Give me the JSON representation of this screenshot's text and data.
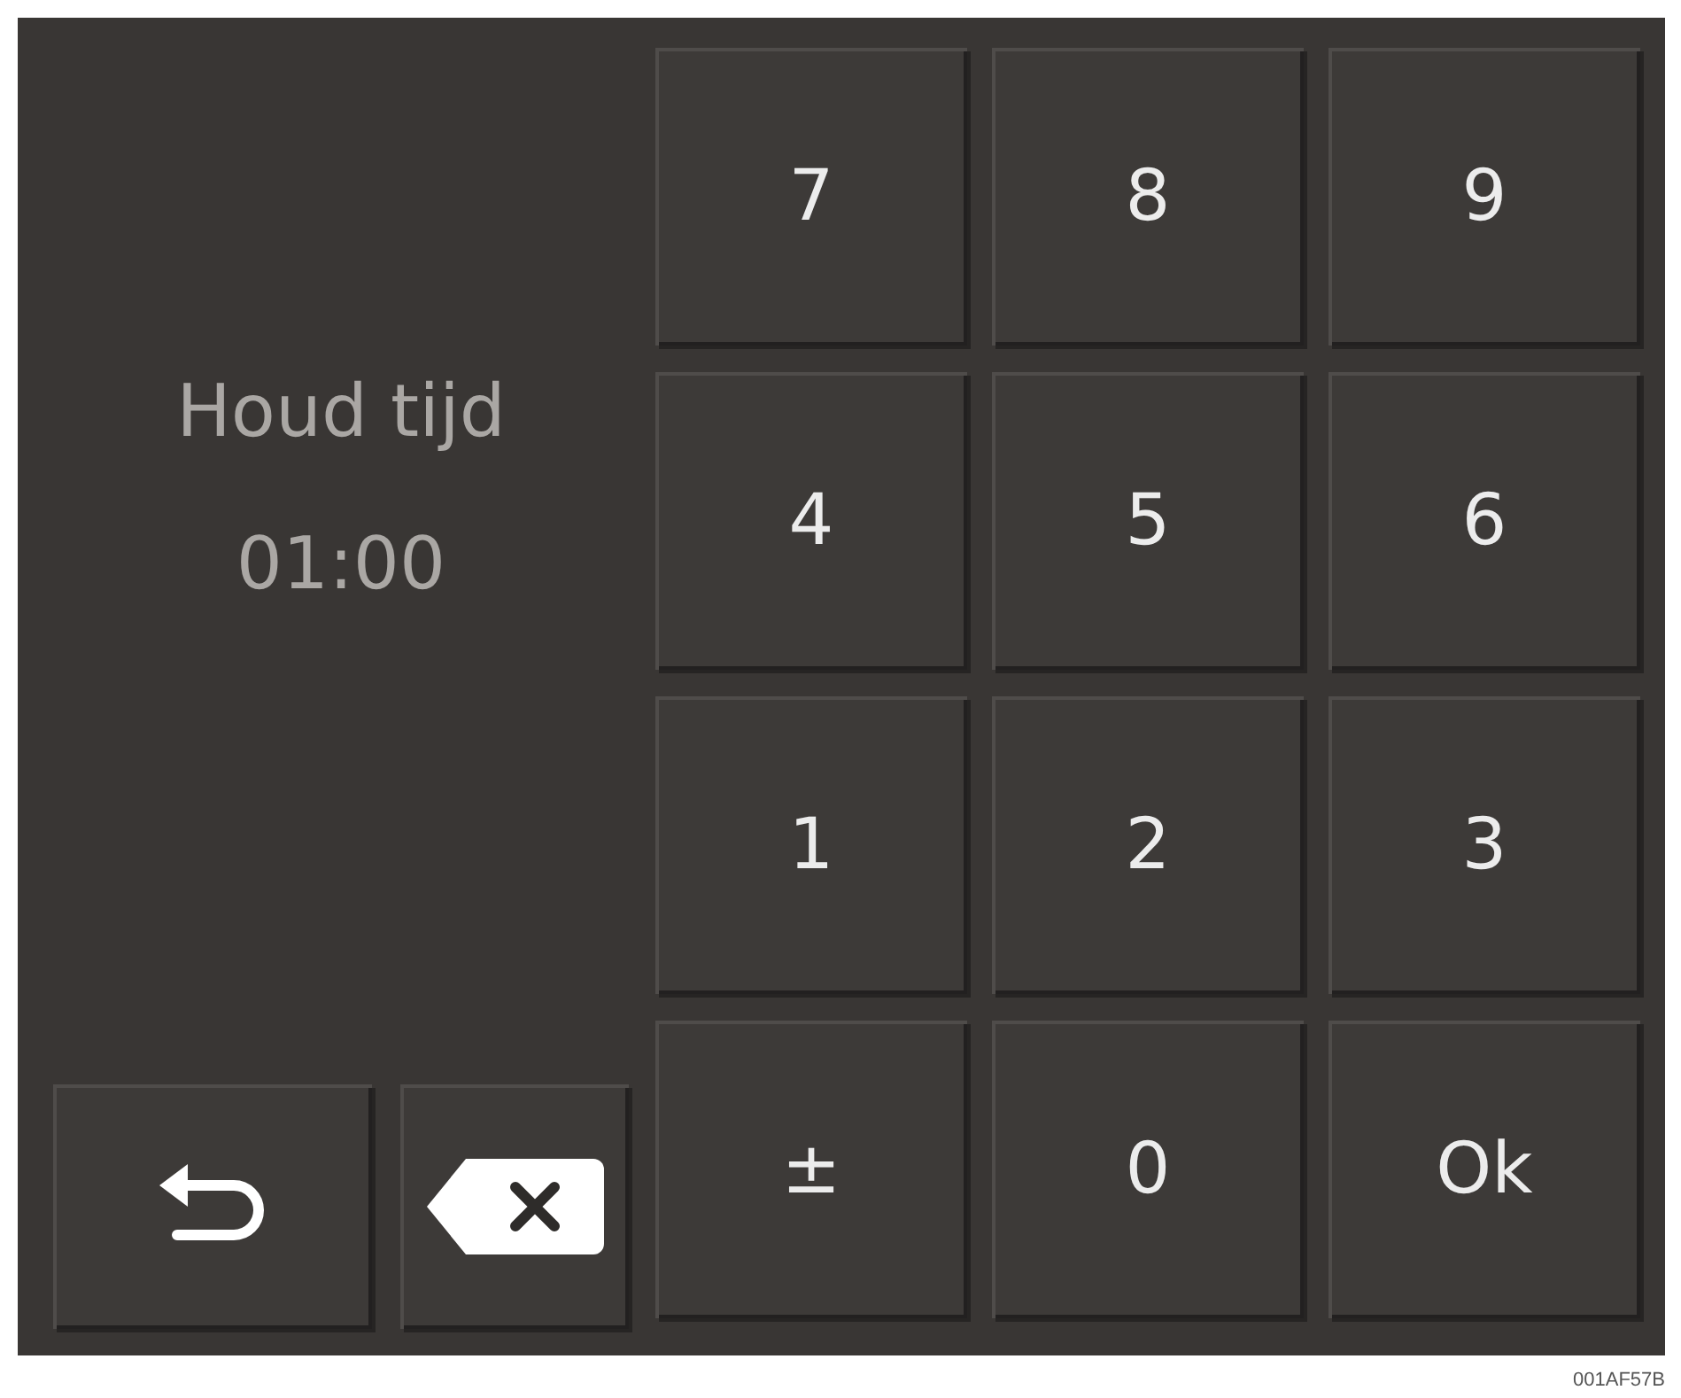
{
  "display": {
    "label": "Houd tijd",
    "value": "01:00"
  },
  "actions": [
    {
      "kind": "back"
    },
    {
      "kind": "delete"
    }
  ],
  "keys": [
    "7",
    "8",
    "9",
    "4",
    "5",
    "6",
    "1",
    "2",
    "3",
    "±",
    "0",
    "Ok"
  ],
  "figure_code": "001AF57B"
}
